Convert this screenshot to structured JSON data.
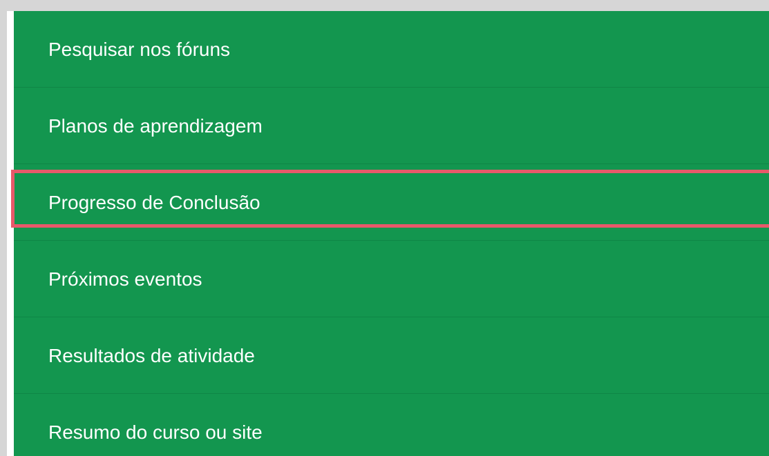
{
  "menu": {
    "items": [
      {
        "label": "Pesquisar nos fóruns"
      },
      {
        "label": "Planos de aprendizagem"
      },
      {
        "label": "Progresso de Conclusão",
        "highlighted": true
      },
      {
        "label": "Próximos eventos"
      },
      {
        "label": "Resultados de atividade"
      },
      {
        "label": "Resumo do curso ou site"
      }
    ]
  },
  "colors": {
    "menu_background": "#13964f",
    "highlight_border": "#e8596a",
    "text": "#ffffff"
  }
}
